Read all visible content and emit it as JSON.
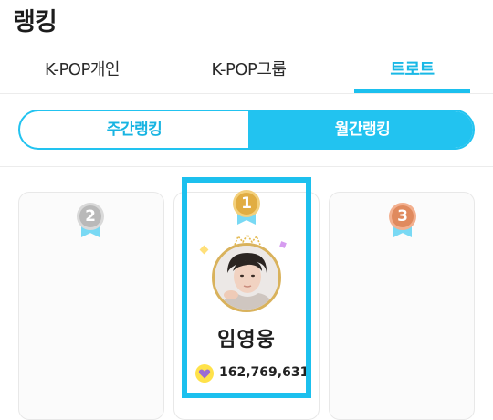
{
  "header": {
    "title": "랭킹"
  },
  "tabs": [
    {
      "label": "K-POP개인"
    },
    {
      "label": "K-POP그룹"
    },
    {
      "label": "트로트"
    }
  ],
  "period": {
    "weekly": "주간랭킹",
    "monthly": "월간랭킹",
    "selected": "monthly"
  },
  "ranking": [
    {
      "rank": "1",
      "name": "임영웅",
      "votes": "162,769,631"
    },
    {
      "rank": "2"
    },
    {
      "rank": "3"
    }
  ],
  "colors": {
    "accent": "#1cc0ee",
    "gold": "#e1ad42",
    "silver": "#b9b9b9",
    "bronze": "#e08a5e"
  }
}
